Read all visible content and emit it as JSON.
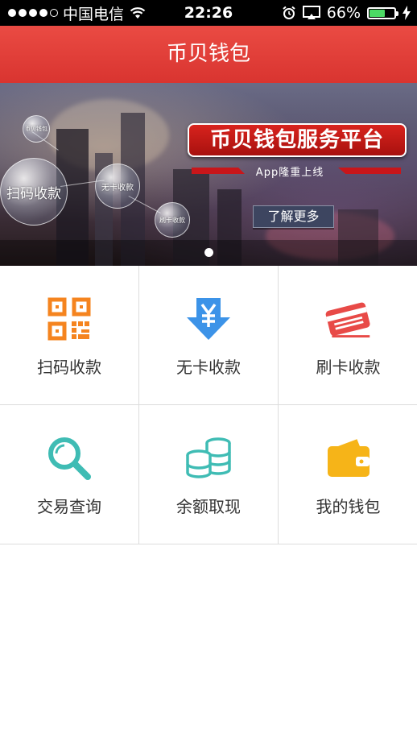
{
  "status_bar": {
    "carrier": "中国电信",
    "time": "22:26",
    "battery": "66%",
    "battery_level": 0.66
  },
  "nav": {
    "title": "币贝钱包"
  },
  "banner": {
    "headline": "币贝钱包服务平台",
    "subline": "App隆重上线",
    "cta": "了解更多",
    "bubbles": {
      "main": "扫码收款",
      "secondary": "无卡收款",
      "swipe": "刷卡收款",
      "small": "币贝钱包"
    },
    "page_count": 1,
    "active_page": 1
  },
  "grid": {
    "items": [
      {
        "label": "扫码收款",
        "icon": "qr-code-icon",
        "color": "#f5841f"
      },
      {
        "label": "无卡收款",
        "icon": "yuan-download-icon",
        "color": "#3c93e8"
      },
      {
        "label": "刷卡收款",
        "icon": "bank-card-icon",
        "color": "#e84a47"
      },
      {
        "label": "交易查询",
        "icon": "magnifier-icon",
        "color": "#3fbcb4"
      },
      {
        "label": "余额取现",
        "icon": "coin-stack-icon",
        "color": "#3fbcb4"
      },
      {
        "label": "我的钱包",
        "icon": "wallet-icon",
        "color": "#f6b418"
      }
    ]
  }
}
